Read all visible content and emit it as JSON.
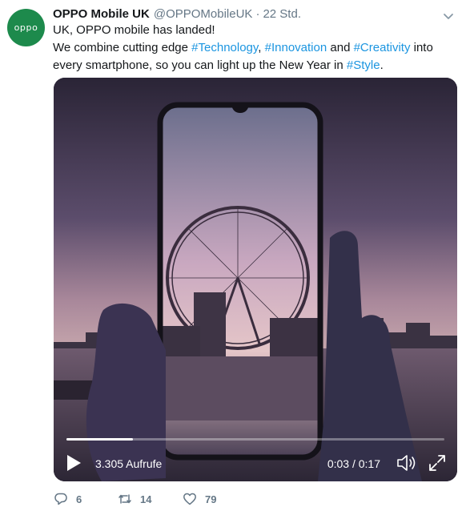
{
  "account": {
    "logo_text": "oppo",
    "name": "OPPO Mobile UK",
    "handle": "@OPPOMobileUK",
    "separator": "·",
    "time": "22 Std."
  },
  "tweet": {
    "line1": "UK, OPPO mobile has landed!",
    "p1": "We combine cutting edge ",
    "tag1": "#Technology",
    "p2": ", ",
    "tag2": "#Innovation",
    "p3": " and ",
    "tag3": "#Creativity",
    "p4": " into every smartphone, so you can light up the New Year in ",
    "tag4": "#Style",
    "p5": "."
  },
  "video": {
    "views": "3.305 Aufrufe",
    "timecode": "0:03 / 0:17",
    "progress": 0.175
  },
  "actions": {
    "replies": "6",
    "retweets": "14",
    "likes": "79"
  },
  "colors": {
    "brand": "#1d8a4c",
    "link": "#1b95e0",
    "muted": "#657786"
  }
}
